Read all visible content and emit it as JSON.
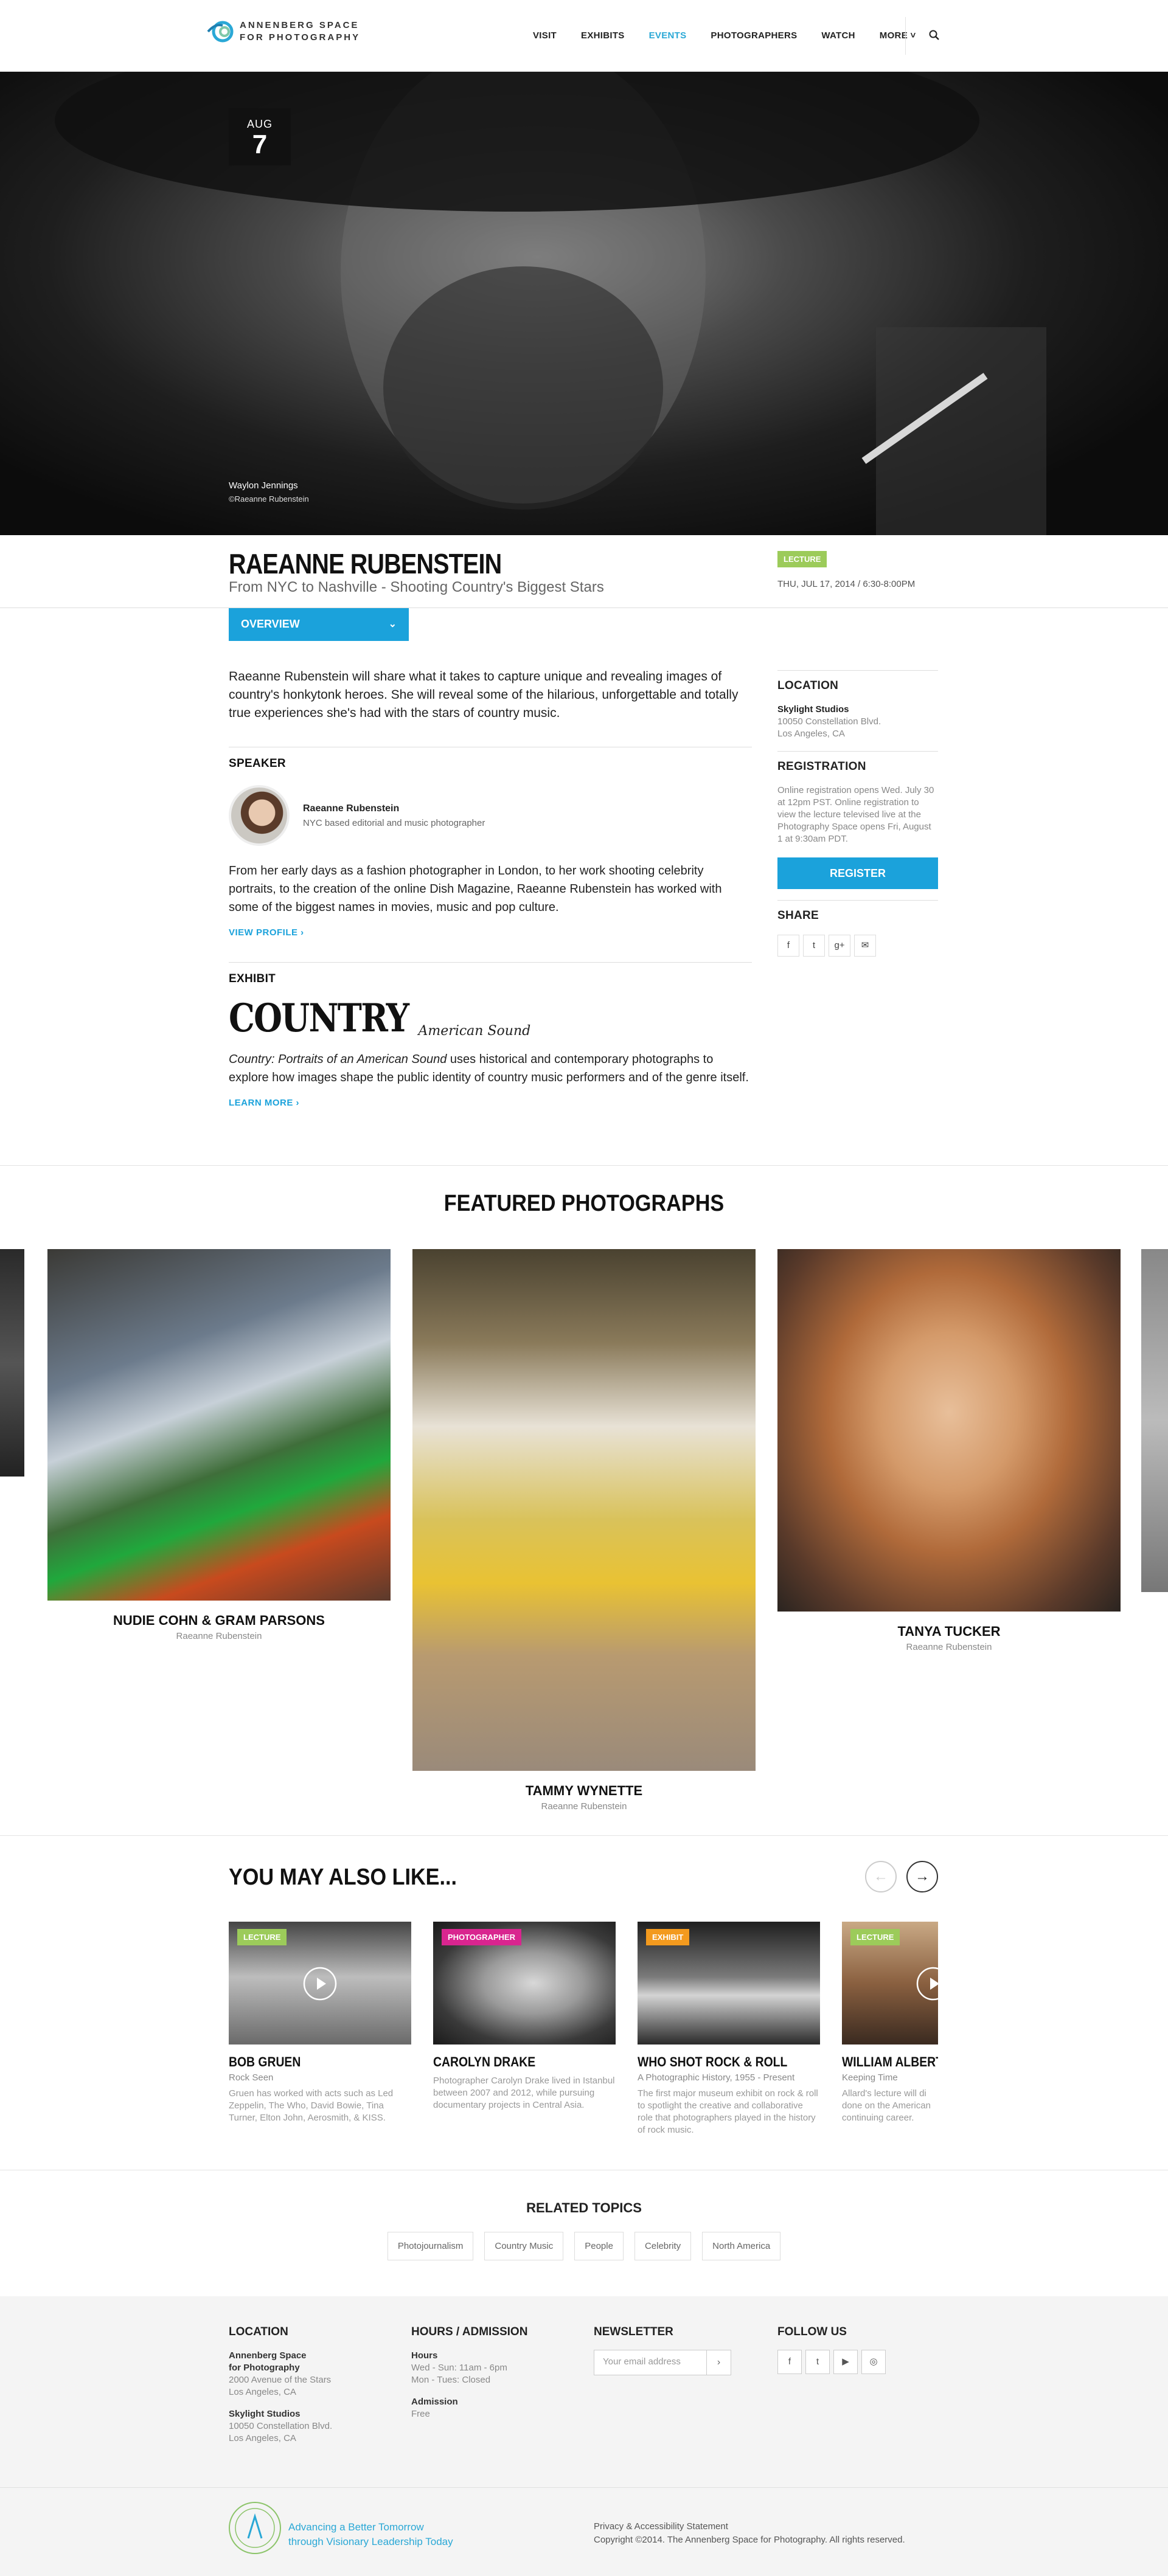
{
  "header": {
    "logo_line1": "ANNENBERG SPACE",
    "logo_line2": "FOR PHOTOGRAPHY",
    "nav": [
      "VISIT",
      "EXHIBITS",
      "EVENTS",
      "PHOTOGRAPHERS",
      "WATCH",
      "MORE ˅"
    ],
    "active_nav": "EVENTS",
    "search_icon": "search-icon",
    "accent": "#2aa8d6"
  },
  "hero": {
    "date_month": "AUG",
    "date_day": "7",
    "caption": "Waylon Jennings",
    "credit": "©Raeanne Rubenstein"
  },
  "event": {
    "title": "RAEANNE RUBENSTEIN",
    "subtitle": "From NYC to Nashville - Shooting Country's Biggest Stars",
    "type_badge": "LECTURE",
    "badge_color": "#9ccb5a",
    "datetime": "THU, JUL 17, 2014 / 6:30-8:00PM",
    "overview_label": "OVERVIEW",
    "lead": "Raeanne Rubenstein will share what it takes to capture unique and revealing images of country's honkytonk heroes. She will reveal some of the hilarious, unforgettable and totally true experiences she's had with the stars of country music."
  },
  "speaker": {
    "heading": "SPEAKER",
    "name": "Raeanne Rubenstein",
    "role": "NYC based editorial and music photographer",
    "bio": "From her early days as a fashion photographer in London, to her work shooting celebrity portraits, to the creation of the online Dish Magazine, Raeanne Rubenstein has worked with some of the biggest names in movies, music and pop culture.",
    "link": "VIEW PROFILE ›"
  },
  "exhibit": {
    "heading": "EXHIBIT",
    "logo_main": "COUNTRY",
    "logo_sub": "American Sound",
    "desc_italic": "Country: Portraits of an American Sound",
    "desc_rest": " uses historical and contemporary photographs to explore how images shape the public identity of country music performers and of the genre itself.",
    "link": "LEARN MORE ›"
  },
  "sidebar": {
    "location_h": "LOCATION",
    "venue": "Skylight Studios",
    "addr1": "10050 Constellation Blvd.",
    "addr2": "Los Angeles, CA",
    "registration_h": "REGISTRATION",
    "registration_text": "Online registration opens Wed. July 30 at 12pm PST. Online registration to view the lecture televised live at the Photography Space opens Fri, August 1 at 9:30am PDT.",
    "register_btn": "REGISTER",
    "share_h": "SHARE",
    "share_icons": [
      "f",
      "t",
      "g+",
      "✉"
    ]
  },
  "featured": {
    "heading": "FEATURED PHOTOGRAPHS",
    "photos": [
      {
        "title": "NUDIE COHN & GRAM PARSONS",
        "by": "Raeanne Rubenstein"
      },
      {
        "title": "TAMMY WYNETTE",
        "by": "Raeanne Rubenstein"
      },
      {
        "title": "TANYA TUCKER",
        "by": "Raeanne Rubenstein"
      }
    ]
  },
  "ymal": {
    "heading": "YOU MAY ALSO LIKE...",
    "prev": "←",
    "next": "→",
    "cards": [
      {
        "badge": "LECTURE",
        "badge_color": "#9ccb5a",
        "title": "BOB GRUEN",
        "sub": "Rock Seen",
        "desc": "Gruen has worked with acts such as Led Zeppelin, The Who, David Bowie, Tina Turner, Elton John, Aerosmith, & KISS."
      },
      {
        "badge": "PHOTOGRAPHER",
        "badge_color": "#d9258f",
        "title": "CAROLYN DRAKE",
        "sub": "",
        "desc": "Photographer Carolyn Drake lived in Istanbul between 2007 and 2012, while pursuing documentary projects in Central Asia."
      },
      {
        "badge": "EXHIBIT",
        "badge_color": "#f39a1e",
        "title": "WHO SHOT ROCK & ROLL",
        "sub": "A Photographic History, 1955 - Present",
        "desc": "The first major museum exhibit on rock & roll to spotlight the creative and collaborative role that photographers played in the history of rock music."
      },
      {
        "badge": "LECTURE",
        "badge_color": "#9ccb5a",
        "title": "WILLIAM ALBERT AI",
        "sub": "Keeping Time",
        "desc": "Allard's lecture will di done on the American continuing career."
      }
    ]
  },
  "related": {
    "heading": "RELATED TOPICS",
    "tags": [
      "Photojournalism",
      "Country Music",
      "People",
      "Celebrity",
      "North America"
    ]
  },
  "footer": {
    "location_h": "LOCATION",
    "loc1_name1": "Annenberg Space",
    "loc1_name2": "for Photography",
    "loc1_addr1": "2000 Avenue of the Stars",
    "loc1_addr2": "Los Angeles, CA",
    "loc2_name": "Skylight Studios",
    "loc2_addr1": "10050 Constellation Blvd.",
    "loc2_addr2": "Los Angeles, CA",
    "hours_h": "HOURS / ADMISSION",
    "hours_label": "Hours",
    "hours1": "Wed - Sun: 11am - 6pm",
    "hours2": "Mon - Tues: Closed",
    "admission_label": "Admission",
    "admission": "Free",
    "newsletter_h": "NEWSLETTER",
    "newsletter_placeholder": "Your email address",
    "newsletter_go": "›",
    "follow_h": "FOLLOW US",
    "follow_icons": [
      "f",
      "t",
      "▶",
      "◎"
    ],
    "tagline1": "Advancing a Better Tomorrow",
    "tagline2": "through Visionary Leadership Today",
    "privacy": "Privacy & Accessibility Statement",
    "copyright": "Copyright ©2014. The Annenberg Space for Photography. All rights reserved."
  }
}
